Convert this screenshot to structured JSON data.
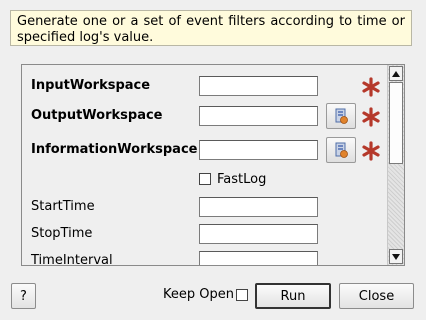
{
  "description": "Generate one or a set of event filters according to time or specified log's value.",
  "properties": [
    {
      "name": "InputWorkspace",
      "value": "",
      "required": true,
      "bold": true,
      "browse": false
    },
    {
      "name": "OutputWorkspace",
      "value": "",
      "required": true,
      "bold": true,
      "browse": true
    },
    {
      "name": "InformationWorkspace",
      "value": "",
      "required": true,
      "bold": true,
      "browse": true
    },
    {
      "name": "StartTime",
      "value": "",
      "required": false,
      "bold": false,
      "browse": false
    },
    {
      "name": "StopTime",
      "value": "",
      "required": false,
      "bold": false,
      "browse": false
    },
    {
      "name": "TimeInterval",
      "value": "",
      "required": false,
      "bold": false,
      "browse": false
    }
  ],
  "fastlog": {
    "label": "FastLog",
    "checked": false
  },
  "scrollbar": {
    "position": 0.0
  },
  "footer": {
    "help_label": "?",
    "keep_open_label": "Keep Open",
    "keep_open_checked": false,
    "run_label": "Run",
    "close_label": "Close"
  },
  "colors": {
    "required_star": "#b5382a",
    "description_bg": "#fffbdc"
  },
  "icons": {
    "browse": "folder-browse-icon",
    "required": "required-star-icon"
  }
}
